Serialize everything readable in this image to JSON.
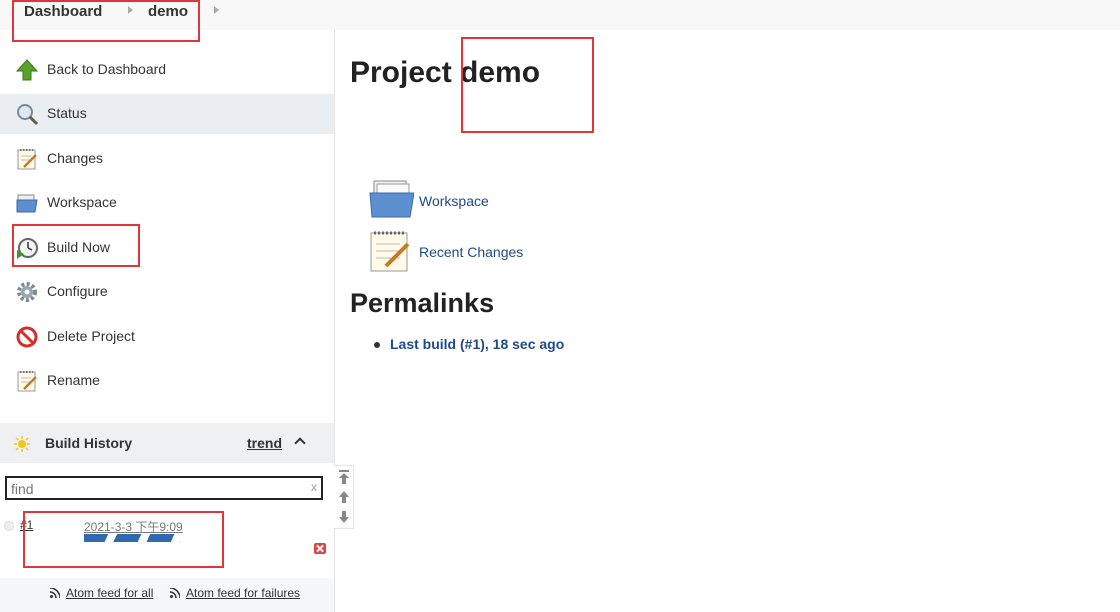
{
  "breadcrumb": {
    "items": [
      "Dashboard",
      "demo"
    ]
  },
  "sidebar": {
    "tasks": [
      {
        "label": "Back to Dashboard",
        "icon": "up-arrow-icon"
      },
      {
        "label": "Status",
        "icon": "magnifier-icon"
      },
      {
        "label": "Changes",
        "icon": "notepad-icon"
      },
      {
        "label": "Workspace",
        "icon": "folder-icon"
      },
      {
        "label": "Build Now",
        "icon": "clock-play-icon"
      },
      {
        "label": "Configure",
        "icon": "gear-icon"
      },
      {
        "label": "Delete Project",
        "icon": "no-entry-icon"
      },
      {
        "label": "Rename",
        "icon": "notepad-icon"
      }
    ]
  },
  "build_history": {
    "title": "Build History",
    "trend_label": "trend",
    "find_placeholder": "find",
    "clear_label": "x",
    "builds": [
      {
        "number": "#1",
        "date": "2021-3-3 下午9:09"
      }
    ],
    "feed_all": "Atom feed for all",
    "feed_failures": "Atom feed for failures"
  },
  "main": {
    "title": "Project demo",
    "links": [
      {
        "label": "Workspace",
        "icon": "folder-icon"
      },
      {
        "label": "Recent Changes",
        "icon": "notepad-icon"
      }
    ],
    "permalinks_title": "Permalinks",
    "permalinks": [
      "Last build (#1), 18 sec ago"
    ]
  },
  "colors": {
    "link": "#204a87",
    "annotation": "#e0363a",
    "progress": "#2f6aad",
    "active_task_bg": "#e9eef2"
  }
}
